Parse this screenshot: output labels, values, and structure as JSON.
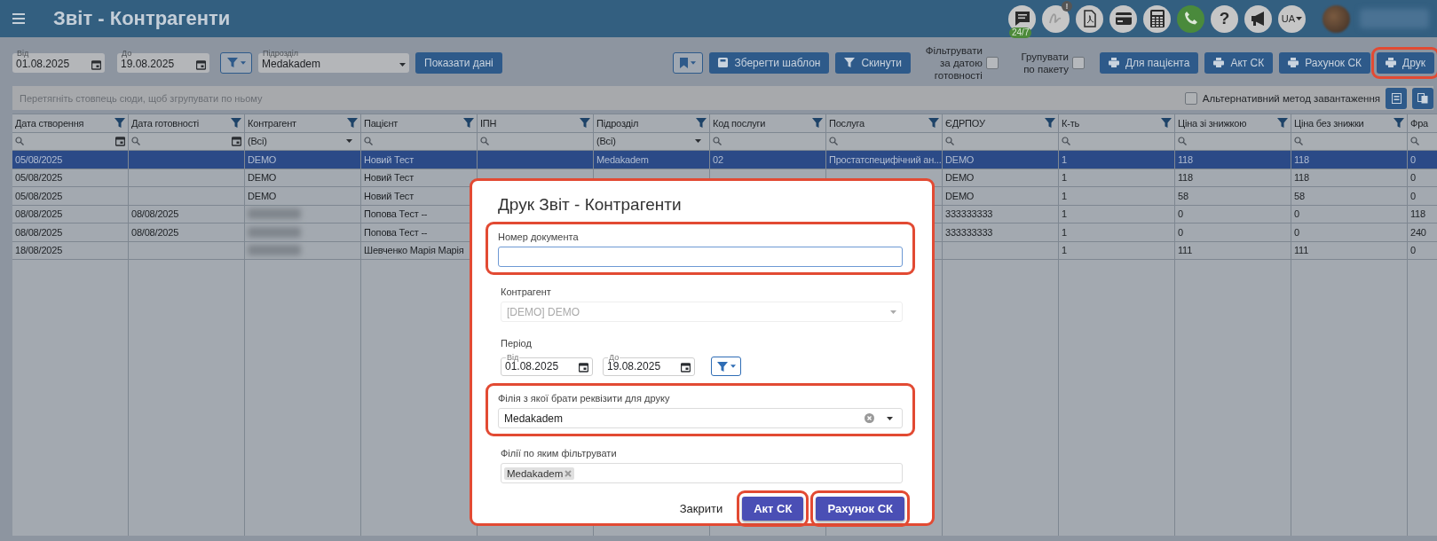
{
  "header": {
    "title": "Звіт - Контрагенти",
    "chat_badge": "24/7",
    "alert_badge": "!",
    "help_glyph": "?",
    "language": "UA"
  },
  "toolbar": {
    "date_from": {
      "label": "Від",
      "value": "01.08.2025"
    },
    "date_to": {
      "label": "До",
      "value": "19.08.2025"
    },
    "department": {
      "label": "Підрозділ",
      "value": "Medakadem"
    },
    "show_button": "Показати дані",
    "save_template": "Зберегти шаблон",
    "reset": "Скинути",
    "checks": [
      {
        "label": "Фільтрувати за датою готовності",
        "checked": false
      },
      {
        "label": "Групувати по пакету",
        "checked": false
      }
    ],
    "actions": [
      {
        "label": "Для пацієнта",
        "highlighted": false
      },
      {
        "label": "Акт СК",
        "highlighted": false
      },
      {
        "label": "Рахунок СК",
        "highlighted": false
      },
      {
        "label": "Друк",
        "highlighted": true
      }
    ]
  },
  "group_panel": {
    "hint": "Перетягніть стовпець сюди, щоб згрупувати по ньому",
    "alt_loading": {
      "label": "Альтернативний метод завантаження",
      "checked": false
    }
  },
  "table": {
    "columns": [
      {
        "label": "Дата створення",
        "kind": "date"
      },
      {
        "label": "Дата готовності",
        "kind": "date"
      },
      {
        "label": "Контрагент",
        "kind": "select",
        "filter_value": "(Всі)"
      },
      {
        "label": "Пацієнт",
        "kind": "search"
      },
      {
        "label": "ІПН",
        "kind": "search"
      },
      {
        "label": "Підрозділ",
        "kind": "select",
        "filter_value": "(Всі)"
      },
      {
        "label": "Код послуги",
        "kind": "search"
      },
      {
        "label": "Послуга",
        "kind": "search"
      },
      {
        "label": "ЄДРПОУ",
        "kind": "search"
      },
      {
        "label": "К-ть",
        "kind": "search"
      },
      {
        "label": "Ціна зі знижкою",
        "kind": "search"
      },
      {
        "label": "Ціна без знижки",
        "kind": "search"
      },
      {
        "label": "Фра",
        "kind": "search"
      }
    ],
    "rows": [
      {
        "selected": true,
        "contractor_blurred": false,
        "cells": [
          "05/08/2025",
          null,
          "DEMO",
          "Новий Тест",
          null,
          "Medakadem",
          "02",
          "Простатспецифічний ан...",
          "DEMO",
          "1",
          "118",
          "118",
          "0"
        ]
      },
      {
        "selected": false,
        "contractor_blurred": false,
        "cells": [
          "05/08/2025",
          null,
          "DEMO",
          "Новий Тест",
          null,
          null,
          null,
          null,
          "DEMO",
          "1",
          "118",
          "118",
          "0"
        ]
      },
      {
        "selected": false,
        "contractor_blurred": false,
        "cells": [
          "05/08/2025",
          null,
          "DEMO",
          "Новий Тест",
          null,
          null,
          null,
          null,
          "DEMO",
          "1",
          "58",
          "58",
          "0"
        ]
      },
      {
        "selected": false,
        "contractor_blurred": true,
        "cells": [
          "08/08/2025",
          "08/08/2025",
          null,
          "Попова Тест --",
          null,
          null,
          null,
          null,
          "333333333",
          "1",
          "0",
          "0",
          "118"
        ]
      },
      {
        "selected": false,
        "contractor_blurred": true,
        "cells": [
          "08/08/2025",
          "08/08/2025",
          null,
          "Попова Тест --",
          null,
          null,
          null,
          null,
          "333333333",
          "1",
          "0",
          "0",
          "240"
        ]
      },
      {
        "selected": false,
        "contractor_blurred": true,
        "cells": [
          "18/08/2025",
          null,
          null,
          "Шевченко Марія Марія",
          null,
          null,
          null,
          null,
          null,
          "1",
          "111",
          "111",
          "0"
        ]
      }
    ]
  },
  "dialog": {
    "highlighted": true,
    "title": "Друк Звіт - Контрагенти",
    "document_number": {
      "label": "Номер документа",
      "focused": true,
      "highlighted": true
    },
    "contractor": {
      "label": "Контрагент",
      "value": "[DEMO] DEMO",
      "disabled": true
    },
    "period": {
      "label": "Період",
      "from": {
        "label": "Від",
        "value": "01.08.2025"
      },
      "to": {
        "label": "До",
        "value": "19.08.2025"
      }
    },
    "branch": {
      "label": "Філія з якої брати реквізити для друку",
      "value": "Medakadem",
      "highlighted": true
    },
    "filter_branches": {
      "label": "Філії по яким фільтрувати",
      "tags": [
        "Medakadem"
      ]
    },
    "buttons": [
      {
        "label": "Закрити",
        "kind": "text",
        "highlighted": false
      },
      {
        "label": "Акт СК",
        "kind": "primary",
        "highlighted": true
      },
      {
        "label": "Рахунок СК",
        "kind": "primary",
        "highlighted": true
      }
    ]
  }
}
